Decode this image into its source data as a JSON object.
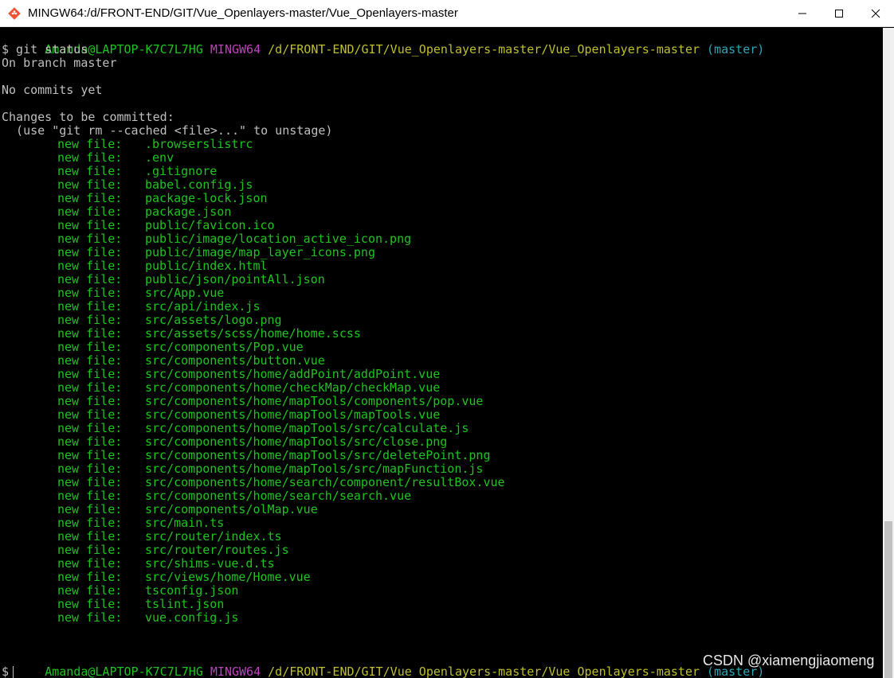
{
  "window": {
    "title": "MINGW64:/d/FRONT-END/GIT/Vue_Openlayers-master/Vue_Openlayers-master",
    "app_icon": "git-diamond-icon",
    "colors": {
      "green": "#1cc51c",
      "purple": "#bf40bf",
      "yellow": "#bfbf28",
      "cyan": "#2aa6b9",
      "text": "#bfbfbf",
      "background": "#000000"
    }
  },
  "terminal": {
    "prompt1": {
      "user": "Amanda@LAPTOP-K7C7L7HG",
      "system": "MINGW64",
      "path": "/d/FRONT-END/GIT/Vue_Openlayers-master/Vue_Openlayers-master",
      "branch": "(master)"
    },
    "command": "$ git status",
    "on_branch": "On branch master",
    "no_commits": "No commits yet",
    "changes_header": "Changes to be committed:",
    "unstage_hint": "  (use \"git rm --cached <file>...\" to unstage)",
    "file_label": "new file:",
    "files": [
      ".browserslistrc",
      ".env",
      ".gitignore",
      "babel.config.js",
      "package-lock.json",
      "package.json",
      "public/favicon.ico",
      "public/image/location_active_icon.png",
      "public/image/map_layer_icons.png",
      "public/index.html",
      "public/json/pointAll.json",
      "src/App.vue",
      "src/api/index.js",
      "src/assets/logo.png",
      "src/assets/scss/home/home.scss",
      "src/components/Pop.vue",
      "src/components/button.vue",
      "src/components/home/addPoint/addPoint.vue",
      "src/components/home/checkMap/checkMap.vue",
      "src/components/home/mapTools/components/pop.vue",
      "src/components/home/mapTools/mapTools.vue",
      "src/components/home/mapTools/src/calculate.js",
      "src/components/home/mapTools/src/close.png",
      "src/components/home/mapTools/src/deletePoint.png",
      "src/components/home/mapTools/src/mapFunction.js",
      "src/components/home/search/component/resultBox.vue",
      "src/components/home/search/search.vue",
      "src/components/olMap.vue",
      "src/main.ts",
      "src/router/index.ts",
      "src/router/routes.js",
      "src/shims-vue.d.ts",
      "src/views/home/Home.vue",
      "tsconfig.json",
      "tslint.json",
      "vue.config.js"
    ],
    "prompt2": {
      "user": "Amanda@LAPTOP-K7C7L7HG",
      "system": "MINGW64",
      "path": "/d/FRONT-END/GIT/Vue_Openlayers-master/Vue_Openlayers-master",
      "branch": "(master)"
    },
    "input_prompt": "$"
  },
  "watermark": "CSDN @xiamengjiaomeng"
}
